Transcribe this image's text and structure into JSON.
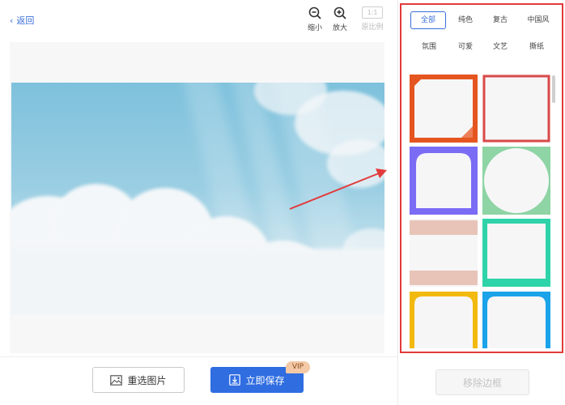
{
  "header": {
    "back_label": "返回",
    "zoom_out_label": "缩小",
    "zoom_in_label": "放大",
    "ratio_value": "1:1",
    "ratio_label": "原比例"
  },
  "categories": [
    {
      "label": "全部",
      "active": true
    },
    {
      "label": "纯色",
      "active": false
    },
    {
      "label": "复古",
      "active": false
    },
    {
      "label": "中国风",
      "active": false
    },
    {
      "label": "氛围",
      "active": false
    },
    {
      "label": "可爱",
      "active": false
    },
    {
      "label": "文艺",
      "active": false
    },
    {
      "label": "撕纸",
      "active": false
    }
  ],
  "frames": [
    {
      "style": "orange-corner",
      "color": "#e5551f"
    },
    {
      "style": "thin-red",
      "color": "#d94a4a"
    },
    {
      "style": "purple-rounded",
      "color": "#7b6cf5"
    },
    {
      "style": "green-circle",
      "color": "#8ed4a4"
    },
    {
      "style": "tape-band",
      "color": "#e8c4b8"
    },
    {
      "style": "teal-bracket",
      "color": "#2ed3a9"
    },
    {
      "style": "yellow-arch",
      "color": "#f2b90f"
    },
    {
      "style": "blue-arch",
      "color": "#1aa3e8"
    }
  ],
  "buttons": {
    "reselect_label": "重选图片",
    "save_label": "立即保存",
    "vip_badge": "VIP",
    "remove_label": "移除边框"
  },
  "colors": {
    "accent": "#2f6de1",
    "highlight_border": "#e23b3b"
  }
}
